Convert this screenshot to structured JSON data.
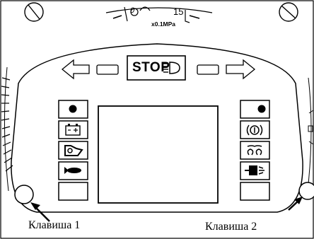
{
  "top_gauge": {
    "unit_label": "x0.1MPa",
    "scale_value": "15",
    "scale_zero": "0"
  },
  "center": {
    "stop_label": "STOP"
  },
  "left_column_icons": [
    "indicator-dot-icon",
    "battery-icon",
    "oil-can-icon",
    "fish-icon",
    "blank"
  ],
  "right_column_icons": [
    "indicator-dot-icon",
    "parking-brake-icon",
    "glow-plug-icon",
    "filter-icon",
    "blank"
  ],
  "captions": {
    "key_1": "Клавиша 1",
    "key_2": "Клавиша 2"
  }
}
